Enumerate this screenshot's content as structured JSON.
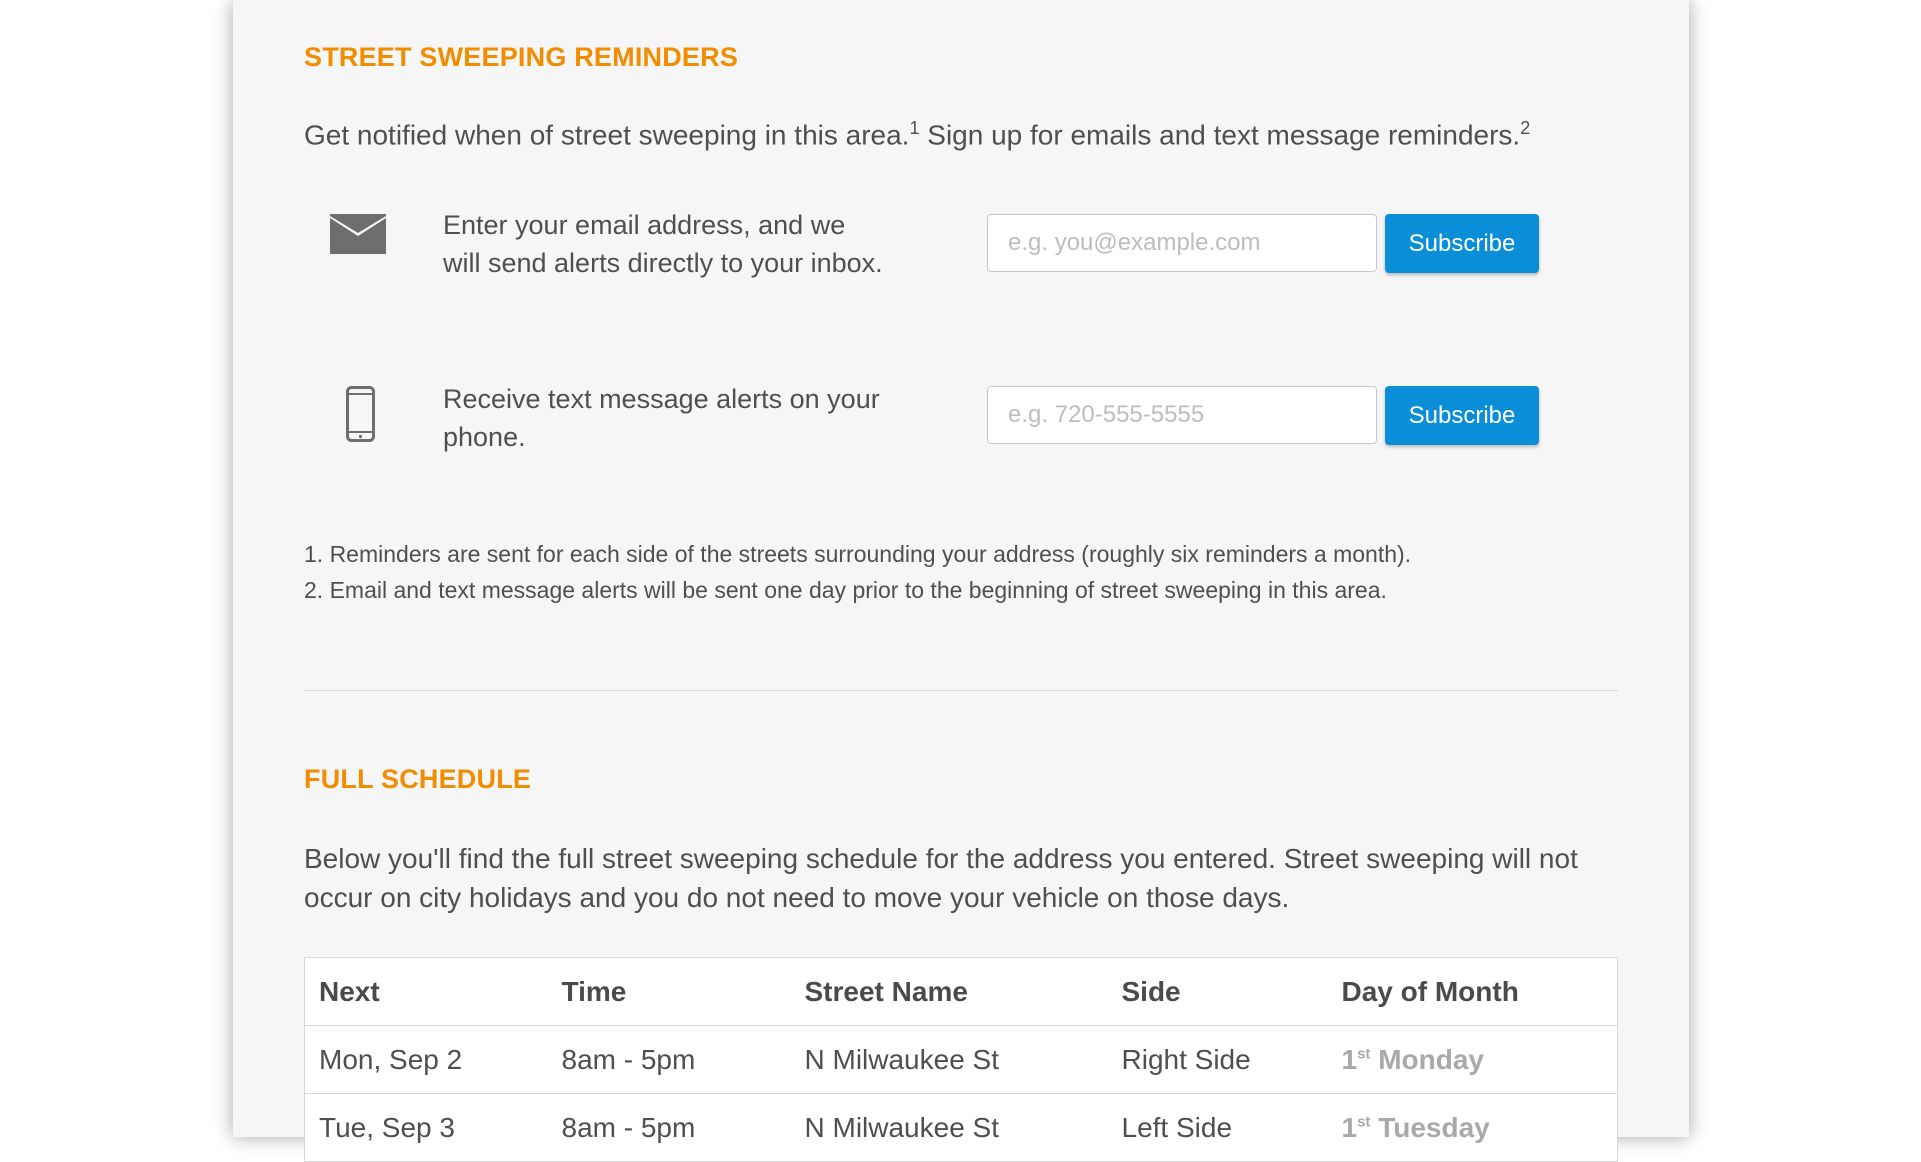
{
  "reminders": {
    "heading": "STREET SWEEPING REMINDERS",
    "intro_part1": "Get notified when of street sweeping in this area.",
    "intro_sup1": "1",
    "intro_part2": " Sign up for emails and text message reminders.",
    "intro_sup2": "2",
    "email": {
      "icon": "envelope-icon",
      "text": "Enter your email address, and we will send alerts directly to your inbox.",
      "placeholder": "e.g. you@example.com",
      "button_label": "Subscribe"
    },
    "sms": {
      "icon": "phone-icon",
      "text": "Receive text message alerts on your phone.",
      "placeholder": "e.g. 720-555-5555",
      "button_label": "Subscribe"
    },
    "footnotes": [
      "1. Reminders are sent for each side of the streets surrounding your address (roughly six reminders a month).",
      "2. Email and text message alerts will be sent one day prior to the beginning of street sweeping in this area."
    ]
  },
  "schedule": {
    "heading": "FULL SCHEDULE",
    "description": "Below you'll find the full street sweeping schedule for the address you entered. Street sweeping will not occur on city holidays and you do not need to move your vehicle on those days.",
    "columns": [
      "Next",
      "Time",
      "Street Name",
      "Side",
      "Day of Month"
    ],
    "rows": [
      {
        "next": "Mon, Sep 2",
        "time": "8am - 5pm",
        "street": "N Milwaukee St",
        "side": "Right Side",
        "day_num": "1",
        "day_suffix": "st",
        "day_name": "Monday"
      },
      {
        "next": "Tue, Sep 3",
        "time": "8am - 5pm",
        "street": "N Milwaukee St",
        "side": "Left Side",
        "day_num": "1",
        "day_suffix": "st",
        "day_name": "Tuesday"
      }
    ]
  },
  "colors": {
    "heading": "#f28c00",
    "button": "#0a8ed7",
    "day_of_month": "#a9a9a9"
  }
}
